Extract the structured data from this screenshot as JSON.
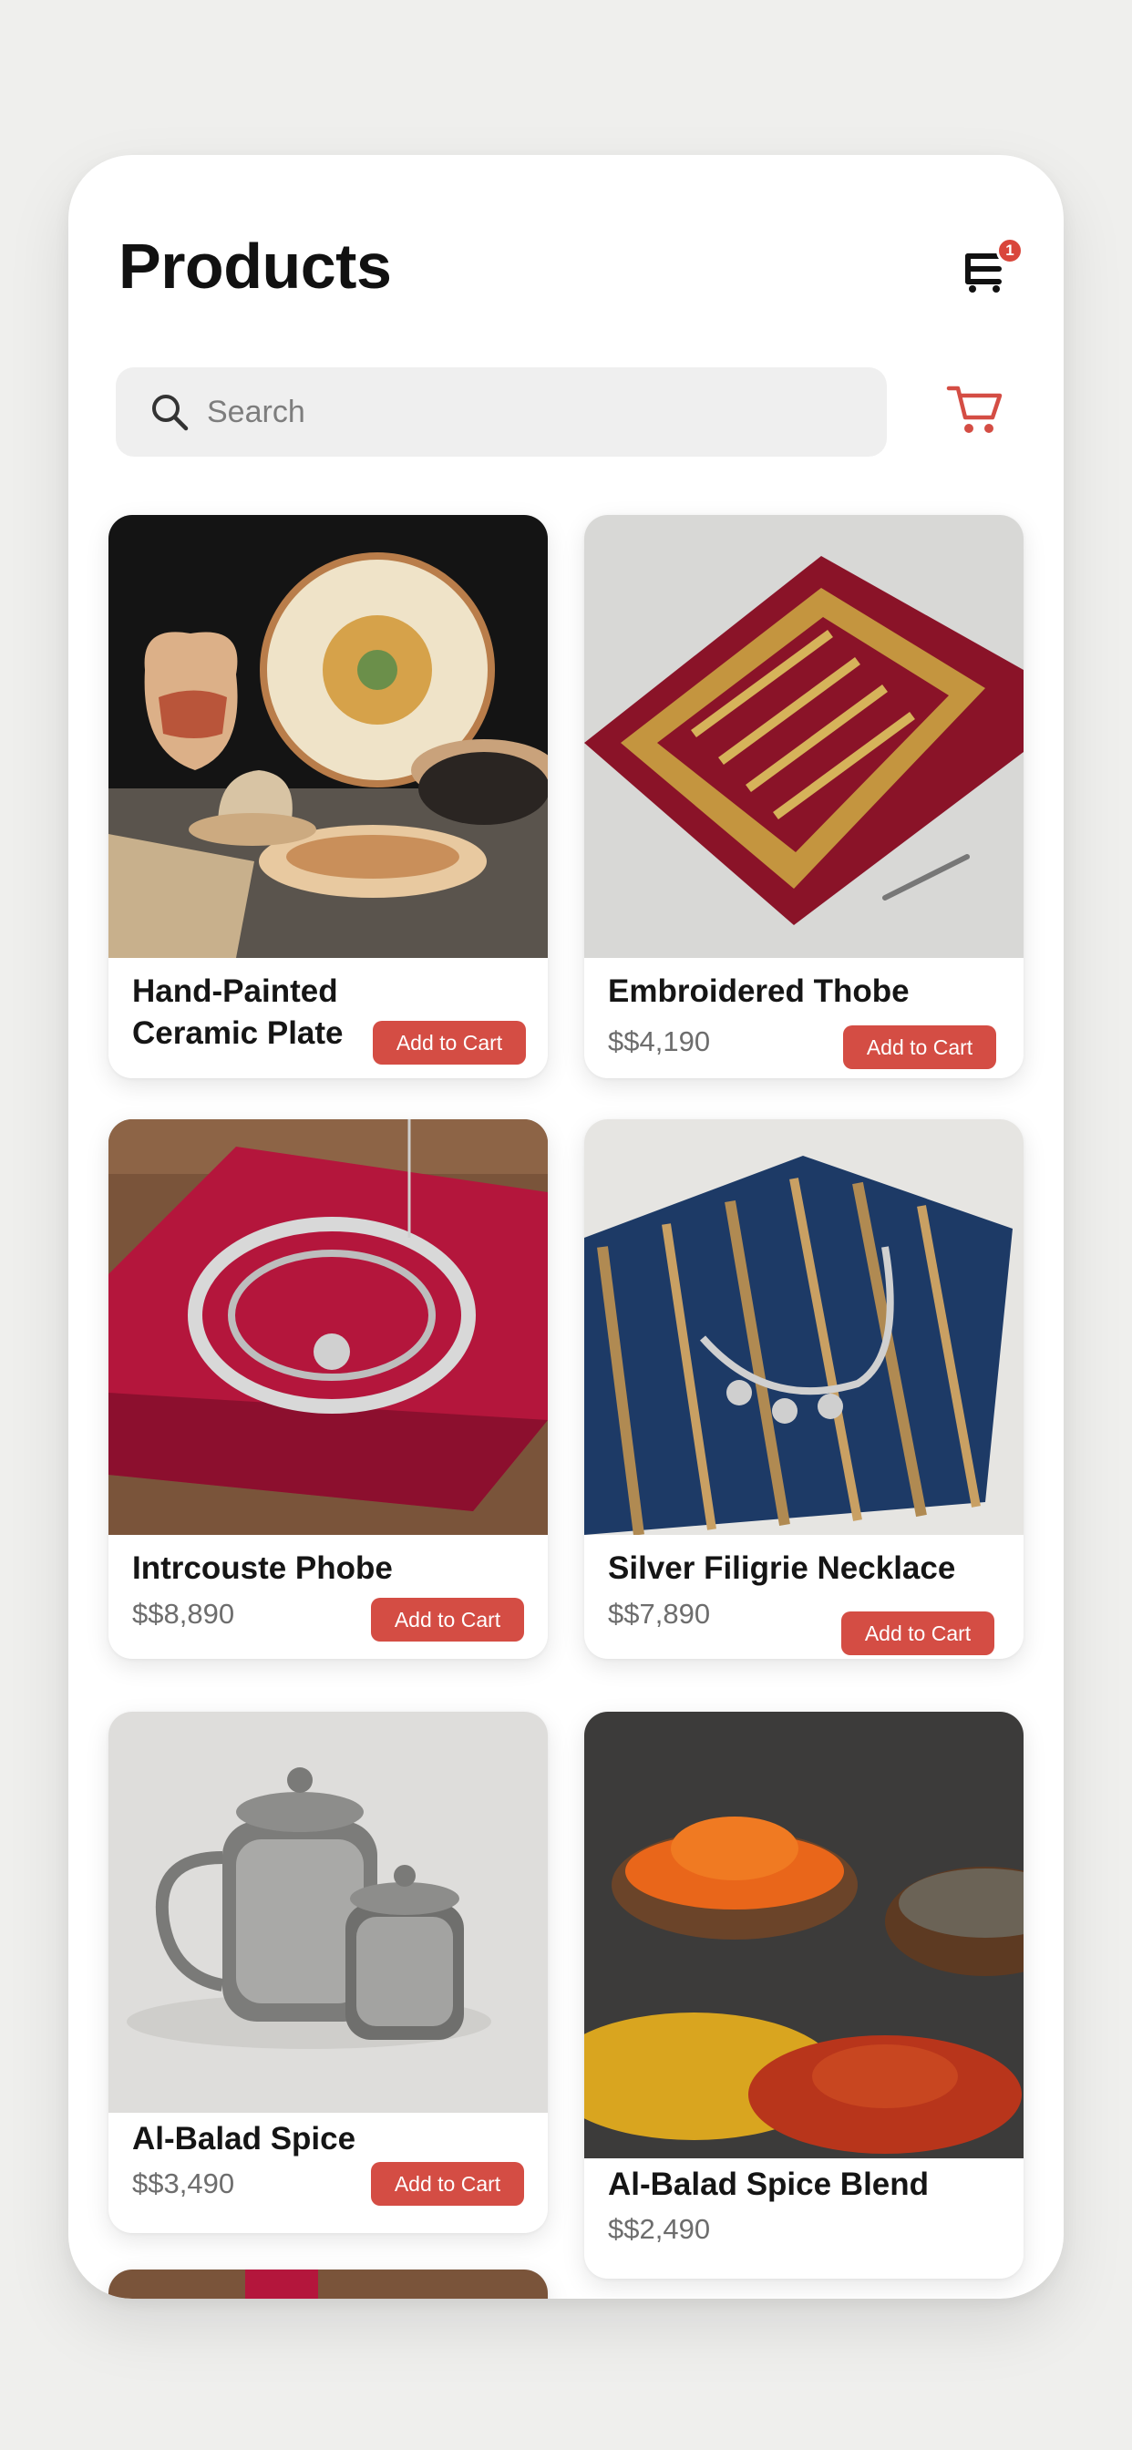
{
  "header": {
    "title": "Products",
    "menu_badge_count": "1"
  },
  "search": {
    "placeholder": "Search",
    "value": ""
  },
  "colors": {
    "accent": "#d44d44",
    "badge": "#d9463b",
    "search_bg": "#efefef"
  },
  "icons": [
    "search-icon",
    "cart-icon",
    "menu-icon"
  ],
  "products": [
    {
      "name_line1": "Hand-Painted",
      "name_line2": "Ceramic Plate",
      "price": "",
      "button": "Add to Cart",
      "image": "ceramic pottery set"
    },
    {
      "name_line1": "Embroidered Thobe",
      "name_line2": "",
      "price": "$$4,190",
      "button": "Add to Cart",
      "image": "red embroidered textile"
    },
    {
      "name_line1": "Intrcouste Phobe",
      "name_line2": "",
      "price": "$$8,890",
      "button": "Add to Cart",
      "image": "red cloth with silver necklace"
    },
    {
      "name_line1": "Silver Filigrie Necklace",
      "name_line2": "",
      "price": "$$7,890",
      "button": "Add to Cart",
      "image": "striped blue textile with necklace"
    },
    {
      "name_line1": "Al-Balad Spice",
      "name_line2": "",
      "price": "$$3,490",
      "button": "Add to Cart",
      "image": "silver teapot and jar"
    },
    {
      "name_line1": "Al-Balad Spice Blend",
      "name_line2": "",
      "price": "$$2,490",
      "button": "",
      "image": "spice bowls"
    }
  ]
}
